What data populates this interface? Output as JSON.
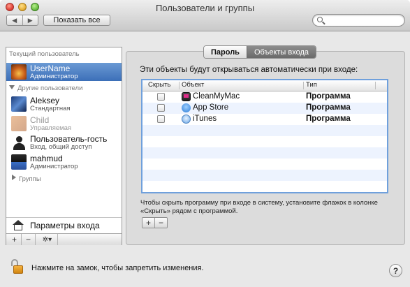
{
  "window": {
    "title": "Пользователи и группы"
  },
  "toolbar": {
    "back_glyph": "◀",
    "forward_glyph": "▶",
    "show_all_label": "Показать все",
    "search_placeholder": ""
  },
  "sidebar": {
    "current_user_header": "Текущий пользователь",
    "current_user": {
      "name": "UserName",
      "role": "Администратор",
      "avatar_color": "#e07a2a"
    },
    "other_users_header": "Другие пользователи",
    "other_users": [
      {
        "name": "Aleksey",
        "role": "Стандартная"
      },
      {
        "name": "Child",
        "role": "Управляемая"
      },
      {
        "name": "Пользователь-гость",
        "role": "Вход, общий доступ"
      },
      {
        "name": "mahmud",
        "role": "Администратор"
      }
    ],
    "groups_label": "Группы",
    "login_options_label": "Параметры входа",
    "bottom_buttons": {
      "add": "+",
      "remove": "−",
      "action": "✲▾"
    }
  },
  "tabs": {
    "password": "Пароль",
    "login_items": "Объекты входа",
    "selected": "Объекты входа"
  },
  "login_items": {
    "intro": "Эти объекты будут открываться автоматически при входе:",
    "columns": {
      "hide": "Скрыть",
      "item": "Объект",
      "kind": "Тип"
    },
    "rows": [
      {
        "name": "CleanMyMac",
        "kind": "Программа",
        "hidden": false,
        "icon": "cleanmymac-icon"
      },
      {
        "name": "App Store",
        "kind": "Программа",
        "hidden": false,
        "icon": "app-store-icon"
      },
      {
        "name": "iTunes",
        "kind": "Программа",
        "hidden": false,
        "icon": "itunes-icon"
      }
    ],
    "hint": "Чтобы скрыть программу при входе в систему, установите флажок в колонке «Скрыть» рядом с программой.",
    "add": "+",
    "remove": "−"
  },
  "footer": {
    "lock_text": "Нажмите на замок, чтобы запретить изменения.",
    "help": "?"
  },
  "colors": {
    "selection": "#3c6fb8",
    "table_focus": "#6fa0dc",
    "alt_row": "#edf3fe"
  }
}
